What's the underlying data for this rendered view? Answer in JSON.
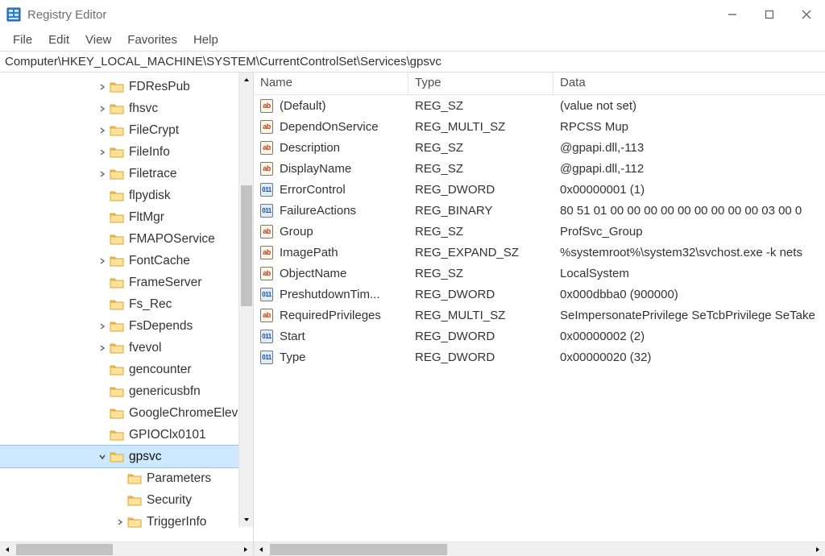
{
  "app": {
    "title": "Registry Editor"
  },
  "menu": {
    "file": "File",
    "edit": "Edit",
    "view": "View",
    "favorites": "Favorites",
    "help": "Help"
  },
  "address": "Computer\\HKEY_LOCAL_MACHINE\\SYSTEM\\CurrentControlSet\\Services\\gpsvc",
  "tree": {
    "indent_base": 120,
    "items": [
      {
        "label": "FDResPub",
        "expander": "closed",
        "depth": 0
      },
      {
        "label": "fhsvc",
        "expander": "closed",
        "depth": 0
      },
      {
        "label": "FileCrypt",
        "expander": "closed",
        "depth": 0
      },
      {
        "label": "FileInfo",
        "expander": "closed",
        "depth": 0
      },
      {
        "label": "Filetrace",
        "expander": "closed",
        "depth": 0
      },
      {
        "label": "flpydisk",
        "expander": "none",
        "depth": 0
      },
      {
        "label": "FltMgr",
        "expander": "none",
        "depth": 0
      },
      {
        "label": "FMAPOService",
        "expander": "none",
        "depth": 0
      },
      {
        "label": "FontCache",
        "expander": "closed",
        "depth": 0
      },
      {
        "label": "FrameServer",
        "expander": "none",
        "depth": 0
      },
      {
        "label": "Fs_Rec",
        "expander": "none",
        "depth": 0
      },
      {
        "label": "FsDepends",
        "expander": "closed",
        "depth": 0
      },
      {
        "label": "fvevol",
        "expander": "closed",
        "depth": 0
      },
      {
        "label": "gencounter",
        "expander": "none",
        "depth": 0
      },
      {
        "label": "genericusbfn",
        "expander": "none",
        "depth": 0
      },
      {
        "label": "GoogleChromeElev",
        "expander": "none",
        "depth": 0
      },
      {
        "label": "GPIOClx0101",
        "expander": "none",
        "depth": 0
      },
      {
        "label": "gpsvc",
        "expander": "open",
        "depth": 0,
        "selected": true
      },
      {
        "label": "Parameters",
        "expander": "none",
        "depth": 1
      },
      {
        "label": "Security",
        "expander": "none",
        "depth": 1
      },
      {
        "label": "TriggerInfo",
        "expander": "closed",
        "depth": 1
      }
    ]
  },
  "list": {
    "headers": {
      "name": "Name",
      "type": "Type",
      "data": "Data"
    },
    "rows": [
      {
        "icon": "sz",
        "name": "(Default)",
        "type": "REG_SZ",
        "data": "(value not set)"
      },
      {
        "icon": "sz",
        "name": "DependOnService",
        "type": "REG_MULTI_SZ",
        "data": "RPCSS Mup"
      },
      {
        "icon": "sz",
        "name": "Description",
        "type": "REG_SZ",
        "data": "@gpapi.dll,-113"
      },
      {
        "icon": "sz",
        "name": "DisplayName",
        "type": "REG_SZ",
        "data": "@gpapi.dll,-112"
      },
      {
        "icon": "num",
        "name": "ErrorControl",
        "type": "REG_DWORD",
        "data": "0x00000001 (1)"
      },
      {
        "icon": "num",
        "name": "FailureActions",
        "type": "REG_BINARY",
        "data": "80 51 01 00 00 00 00 00 00 00 00 00 03 00 0"
      },
      {
        "icon": "sz",
        "name": "Group",
        "type": "REG_SZ",
        "data": "ProfSvc_Group"
      },
      {
        "icon": "sz",
        "name": "ImagePath",
        "type": "REG_EXPAND_SZ",
        "data": "%systemroot%\\system32\\svchost.exe -k nets"
      },
      {
        "icon": "sz",
        "name": "ObjectName",
        "type": "REG_SZ",
        "data": "LocalSystem"
      },
      {
        "icon": "num",
        "name": "PreshutdownTim...",
        "type": "REG_DWORD",
        "data": "0x000dbba0 (900000)"
      },
      {
        "icon": "sz",
        "name": "RequiredPrivileges",
        "type": "REG_MULTI_SZ",
        "data": "SeImpersonatePrivilege SeTcbPrivilege SeTake"
      },
      {
        "icon": "num",
        "name": "Start",
        "type": "REG_DWORD",
        "data": "0x00000002 (2)"
      },
      {
        "icon": "num",
        "name": "Type",
        "type": "REG_DWORD",
        "data": "0x00000020 (32)"
      }
    ]
  }
}
